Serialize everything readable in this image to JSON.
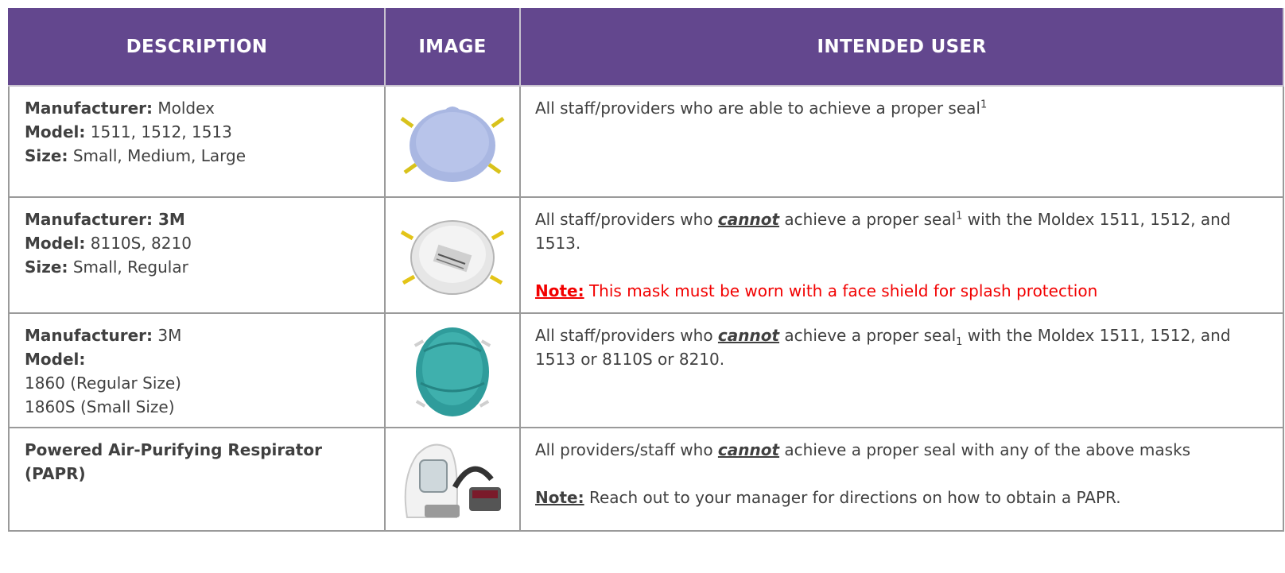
{
  "headers": {
    "description": "DESCRIPTION",
    "image": "IMAGE",
    "intended_user": "INTENDED USER"
  },
  "rows": [
    {
      "manufacturer_label": "Manufacturer:",
      "manufacturer": " Moldex",
      "model_label": "Model:",
      "model": " 1511, 1512, 1513",
      "size_label": "Size:",
      "size": " Small, Medium, Large",
      "image_icon": "blue-respirator-mask-icon",
      "user_text": "All staff/providers who are able to achieve a proper seal",
      "user_sup": "1"
    },
    {
      "manufacturer_label": "Manufacturer:",
      "manufacturer": " 3M",
      "model_label": "Model:",
      "model": " 8110S, 8210",
      "size_label": "Size:",
      "size": " Small, Regular",
      "image_icon": "white-n95-mask-icon",
      "user_pre": "All staff/providers who ",
      "user_emph": "cannot",
      "user_mid": " achieve a proper seal",
      "user_sup": "1",
      "user_post": " with the Moldex 1511, 1512, and 1513.",
      "note_label": "Note:",
      "note_text": " This mask must be worn with a face shield for splash protection"
    },
    {
      "manufacturer_label": "Manufacturer:",
      "manufacturer": " 3M",
      "model_label": "Model:",
      "model_line1": "1860 (Regular Size)",
      "model_line2": "1860S (Small Size)",
      "image_icon": "teal-respirator-mask-icon",
      "user_pre": "All staff/providers who ",
      "user_emph": "cannot",
      "user_mid": " achieve a proper seal",
      "user_sub": "1",
      "user_post": " with the Moldex 1511, 1512, and 1513 or 8110S or 8210."
    },
    {
      "title": "Powered Air-Purifying Respirator (PAPR)",
      "image_icon": "papr-hood-respirator-icon",
      "user_pre": "All providers/staff who ",
      "user_emph": "cannot",
      "user_post": " achieve a proper seal with any of the above masks",
      "note_label": "Note:",
      "note_text": " Reach out to your manager for directions on how to obtain a PAPR."
    }
  ],
  "colors": {
    "header_bg": "#63478e",
    "header_text": "#ffffff",
    "note_red": "#f20000",
    "body_text": "#404040"
  }
}
